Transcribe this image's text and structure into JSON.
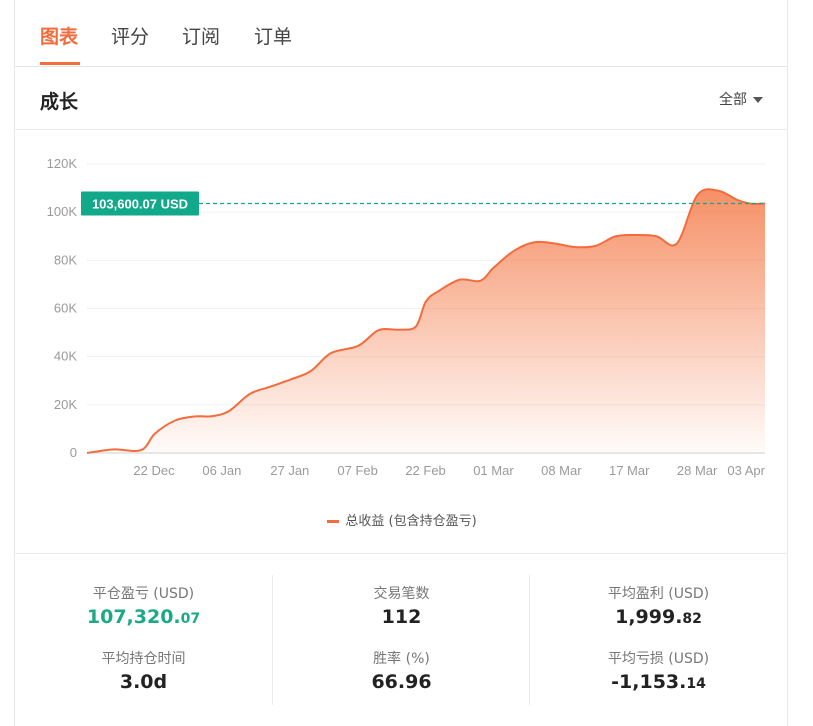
{
  "tabs": [
    {
      "label": "图表",
      "active": true
    },
    {
      "label": "评分",
      "active": false
    },
    {
      "label": "订阅",
      "active": false
    },
    {
      "label": "订单",
      "active": false
    }
  ],
  "section": {
    "title": "成长",
    "filter_label": "全部"
  },
  "colors": {
    "accent": "#f26c3d",
    "marker": "#12a88a",
    "profit_green": "#1ba98a"
  },
  "chart_data": {
    "type": "area",
    "title": "",
    "xlabel": "",
    "ylabel": "",
    "ylim": [
      0,
      120000
    ],
    "y_ticks": [
      "0",
      "20K",
      "40K",
      "60K",
      "80K",
      "100K",
      "120K"
    ],
    "x_ticks": [
      "22 Dec",
      "06 Jan",
      "27 Jan",
      "07 Feb",
      "22 Feb",
      "01 Mar",
      "08 Mar",
      "17 Mar",
      "28 Mar",
      "03 Apr"
    ],
    "marker_label": "103,600.07 USD",
    "marker_value": 103600.07,
    "grid": true,
    "legend_position": "bottom",
    "series": [
      {
        "name": "总收益 (包含持仓盈亏)",
        "x": [
          0,
          0.4,
          0.8,
          1.0,
          1.3,
          1.6,
          1.85,
          2.1,
          2.4,
          2.7,
          3.0,
          3.3,
          3.6,
          4.0,
          4.3,
          4.6,
          4.85,
          5.0,
          5.2,
          5.5,
          5.8,
          6.0,
          6.3,
          6.6,
          6.9,
          7.2,
          7.5,
          7.8,
          8.1,
          8.4,
          8.7,
          9.0,
          9.3,
          9.6,
          9.8,
          10.0
        ],
        "values": [
          0,
          1500,
          1200,
          8000,
          13500,
          15200,
          15300,
          17500,
          24500,
          27500,
          30500,
          34000,
          41500,
          44500,
          51000,
          51200,
          52500,
          63000,
          67500,
          72000,
          71500,
          77000,
          84000,
          87500,
          87000,
          85500,
          86000,
          90000,
          90500,
          90000,
          87000,
          107000,
          109000,
          105000,
          103500,
          103600
        ]
      }
    ]
  },
  "stats": [
    {
      "label": "平仓盈亏 (USD)",
      "value": "107,320.",
      "decimal": "07",
      "tone": "green"
    },
    {
      "label": "交易笔数",
      "value": "112",
      "decimal": "",
      "tone": "normal"
    },
    {
      "label": "平均盈利 (USD)",
      "value": "1,999.",
      "decimal": "82",
      "tone": "normal"
    },
    {
      "label": "平均持仓时间",
      "value": "3.0d",
      "decimal": "",
      "tone": "normal"
    },
    {
      "label": "胜率 (%)",
      "value": "66.96",
      "decimal": "",
      "tone": "normal"
    },
    {
      "label": "平均亏损 (USD)",
      "value": "-1,153.",
      "decimal": "14",
      "tone": "normal"
    }
  ]
}
